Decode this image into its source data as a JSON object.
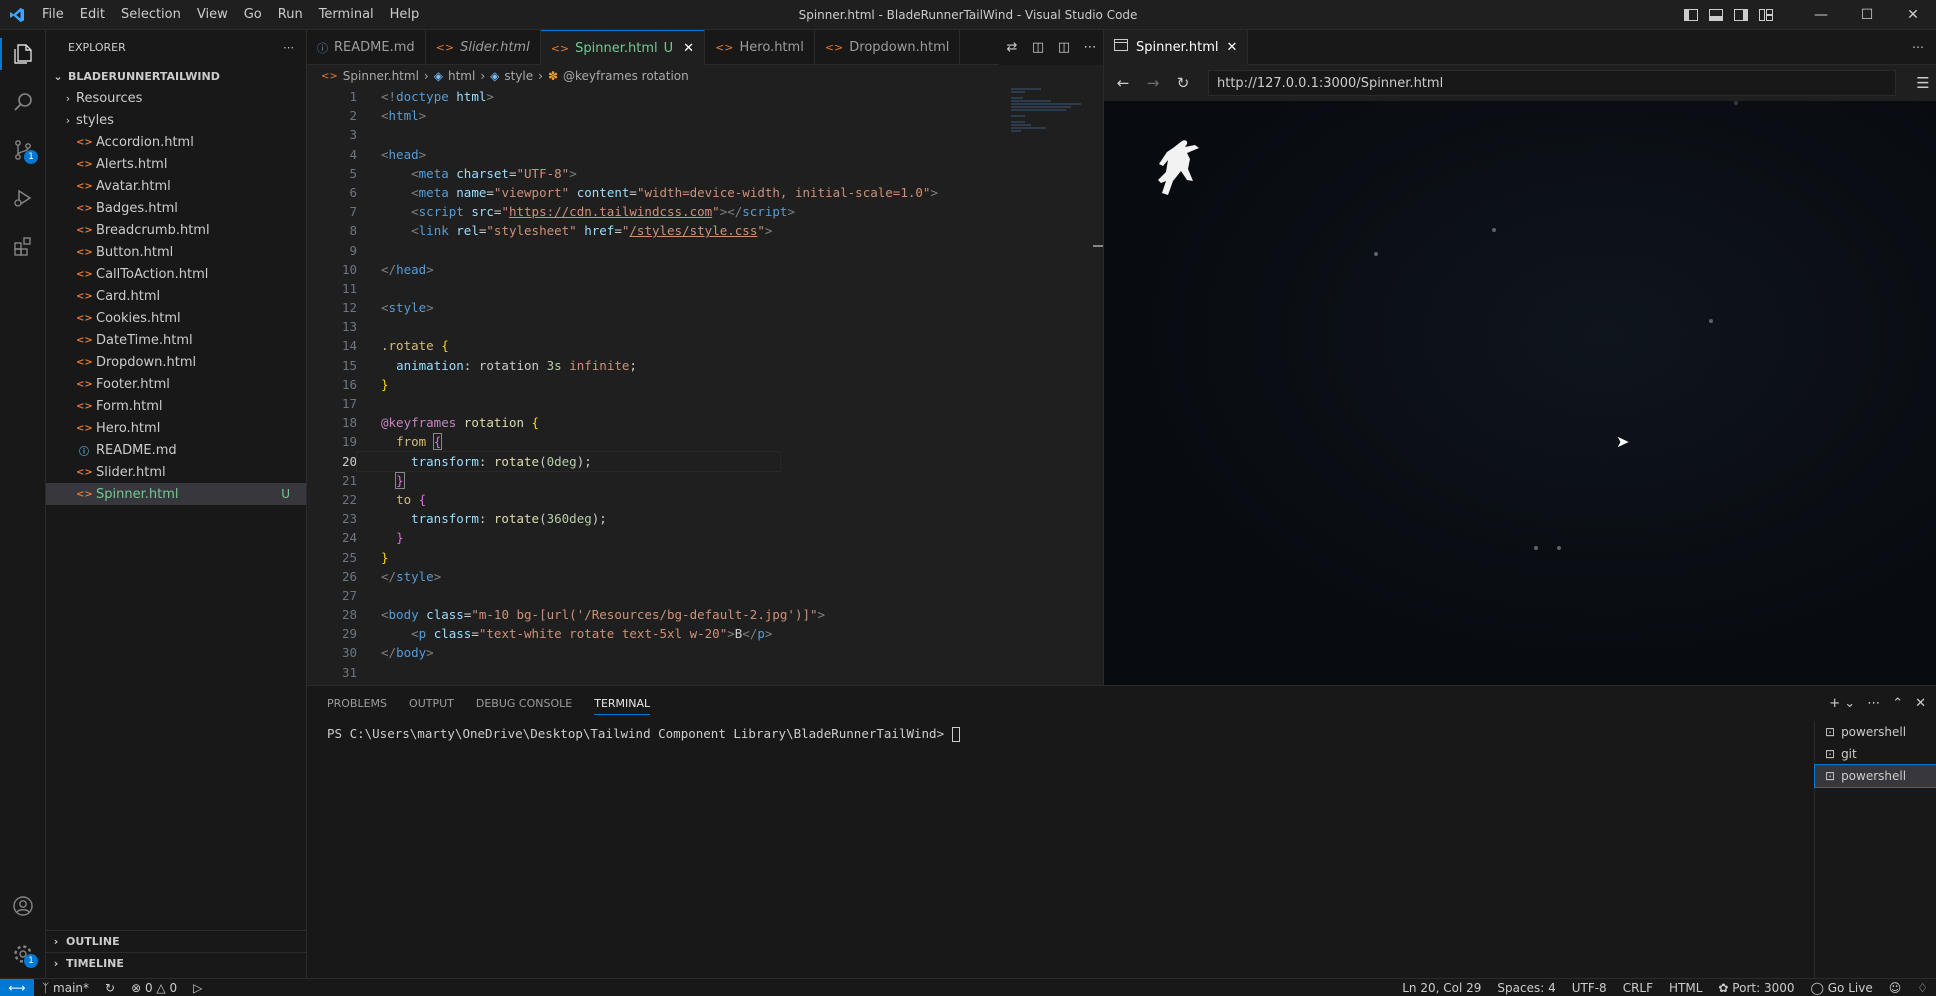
{
  "window": {
    "title": "Spinner.html - BladeRunnerTailWind - Visual Studio Code"
  },
  "menu": [
    "File",
    "Edit",
    "Selection",
    "View",
    "Go",
    "Run",
    "Terminal",
    "Help"
  ],
  "explorer": {
    "header": "EXPLORER",
    "root": "BLADERUNNERTAILWIND",
    "folders": [
      "Resources",
      "styles"
    ],
    "files": [
      {
        "name": "Accordion.html",
        "type": "html"
      },
      {
        "name": "Alerts.html",
        "type": "html"
      },
      {
        "name": "Avatar.html",
        "type": "html"
      },
      {
        "name": "Badges.html",
        "type": "html"
      },
      {
        "name": "Breadcrumb.html",
        "type": "html"
      },
      {
        "name": "Button.html",
        "type": "html"
      },
      {
        "name": "CallToAction.html",
        "type": "html"
      },
      {
        "name": "Card.html",
        "type": "html"
      },
      {
        "name": "Cookies.html",
        "type": "html"
      },
      {
        "name": "DateTime.html",
        "type": "html"
      },
      {
        "name": "Dropdown.html",
        "type": "html"
      },
      {
        "name": "Footer.html",
        "type": "html"
      },
      {
        "name": "Form.html",
        "type": "html"
      },
      {
        "name": "Hero.html",
        "type": "html"
      },
      {
        "name": "README.md",
        "type": "md"
      },
      {
        "name": "Slider.html",
        "type": "html"
      },
      {
        "name": "Spinner.html",
        "type": "html",
        "status": "U"
      }
    ],
    "outline": "OUTLINE",
    "timeline": "TIMELINE"
  },
  "activity_badges": {
    "source_control": "1",
    "settings": "1"
  },
  "editor": {
    "tabs": [
      {
        "label": "README.md",
        "icon": "info-icon"
      },
      {
        "label": "Slider.html",
        "icon": "html-icon",
        "italic": true
      },
      {
        "label": "Spinner.html",
        "status": "U",
        "active": true
      },
      {
        "label": "Hero.html"
      },
      {
        "label": "Dropdown.html"
      }
    ],
    "breadcrumb": [
      "Spinner.html",
      "html",
      "style",
      "@keyframes rotation"
    ],
    "current_line": 20
  },
  "browser": {
    "tab": "Spinner.html",
    "url": "http://127.0.0.1:3000/Spinner.html"
  },
  "panel": {
    "tabs": [
      "PROBLEMS",
      "OUTPUT",
      "DEBUG CONSOLE",
      "TERMINAL"
    ],
    "active_tab": "TERMINAL",
    "prompt": "PS C:\\Users\\marty\\OneDrive\\Desktop\\Tailwind Component Library\\BladeRunnerTailWind> ",
    "terminals": [
      "powershell",
      "git",
      "powershell"
    ]
  },
  "status": {
    "branch": "main*",
    "errors": "0",
    "warnings": "0",
    "position": "Ln 20, Col 29",
    "spaces": "Spaces: 4",
    "encoding": "UTF-8",
    "eol": "CRLF",
    "language": "HTML",
    "port": "Port: 3000",
    "golive": "Go Live"
  },
  "colors": {
    "accent": "#0078d4",
    "untracked": "#73c991",
    "html_icon": "#e37933",
    "md_icon": "#519aba"
  }
}
